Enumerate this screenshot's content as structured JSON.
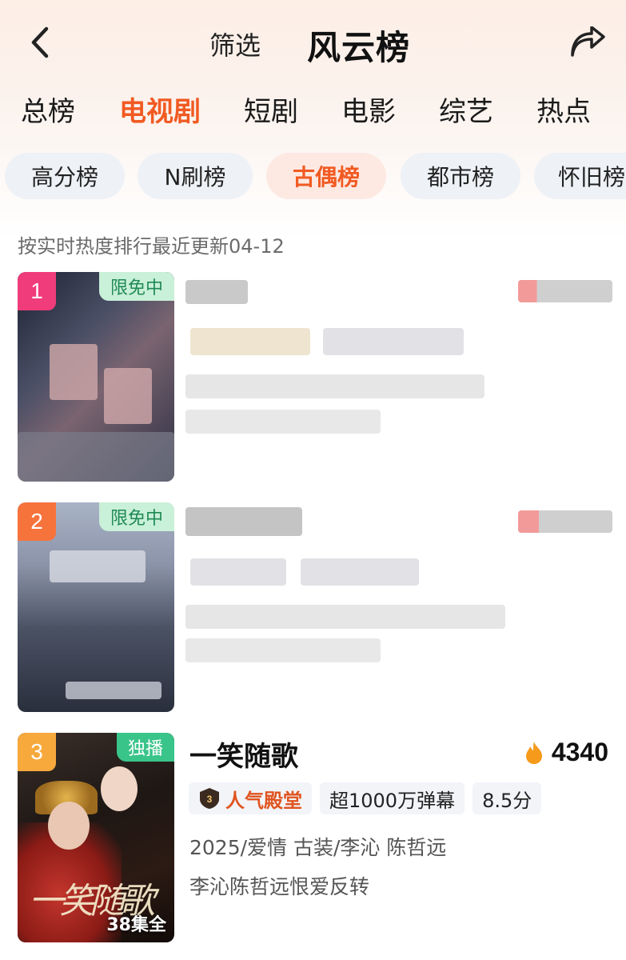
{
  "header": {
    "filter_label": "筛选",
    "title": "风云榜",
    "back_icon": "chevron-left-icon",
    "share_icon": "share-arrow-icon"
  },
  "category_tabs": [
    {
      "label": "总榜",
      "active": false
    },
    {
      "label": "电视剧",
      "active": true
    },
    {
      "label": "短剧",
      "active": false
    },
    {
      "label": "电影",
      "active": false
    },
    {
      "label": "综艺",
      "active": false
    },
    {
      "label": "热点",
      "active": false
    }
  ],
  "sub_tabs": [
    {
      "label": "高分榜",
      "active": false
    },
    {
      "label": "N刷榜",
      "active": false
    },
    {
      "label": "古偶榜",
      "active": true
    },
    {
      "label": "都市榜",
      "active": false
    },
    {
      "label": "怀旧榜",
      "active": false
    }
  ],
  "update_note": "按实时热度排行最近更新04-12",
  "items": [
    {
      "rank": "1",
      "badge": "限免中",
      "rank_color": "#f03c7a"
    },
    {
      "rank": "2",
      "badge": "限免中",
      "rank_color": "#f7733c"
    },
    {
      "rank": "3",
      "badge": "独播",
      "rank_color": "#f7a93c",
      "title": "一笑随歌",
      "heat_icon": "flame-icon",
      "heat": "4340",
      "tags": {
        "hall_icon": "medal-icon",
        "hall": "人气殿堂",
        "danmaku": "超1000万弹幕",
        "score": "8.5分"
      },
      "meta": "2025/爱情 古装/李沁 陈哲远",
      "description": "李沁陈哲远恨爱反转",
      "poster_calligraphy": "一笑随歌",
      "episodes": "38集全"
    }
  ],
  "colors": {
    "accent": "#f15a22",
    "badge_green": "#39c48a",
    "tag_bg": "#f2f4f8"
  }
}
